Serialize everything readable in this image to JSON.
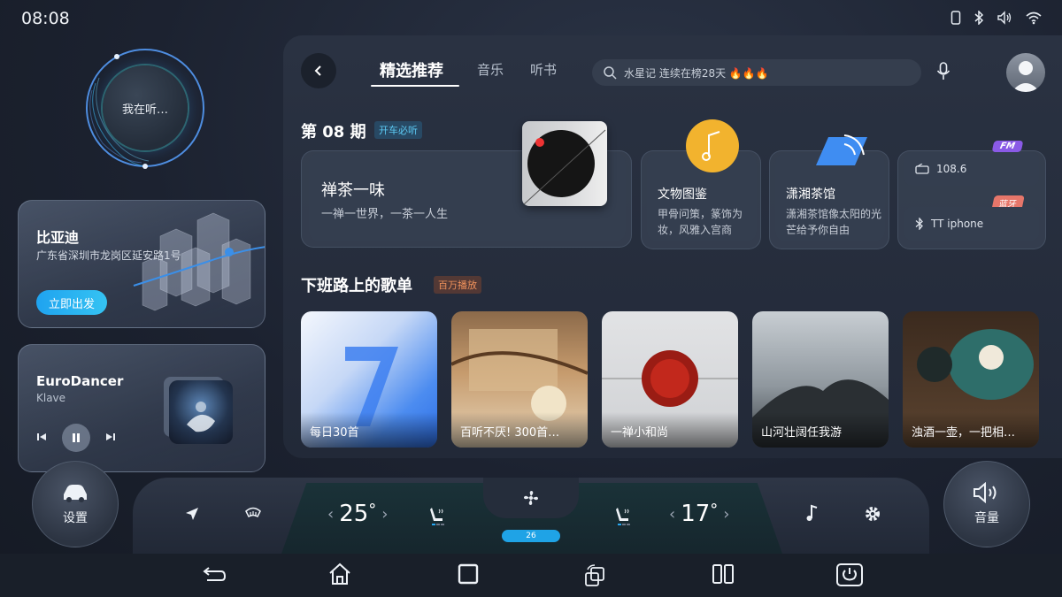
{
  "status_bar": {
    "time": "08:08",
    "icons": [
      "phone-icon",
      "bluetooth-icon",
      "volume-icon",
      "wifi-icon"
    ]
  },
  "listening": {
    "label": "我在听…"
  },
  "nav_card": {
    "title": "比亚迪",
    "address": "广东省深圳市龙岗区延安路1号",
    "button": "立即出发"
  },
  "music_card": {
    "title": "EuroDancer",
    "artist": "Klave"
  },
  "header": {
    "tabs": [
      {
        "label": "精选推荐",
        "active": true
      },
      {
        "label": "音乐",
        "active": false
      },
      {
        "label": "听书",
        "active": false
      }
    ],
    "search_text": "水星记  连续在榜28天  🔥🔥🔥"
  },
  "issue": {
    "title": "第 08 期",
    "tag": "开车必听"
  },
  "feature": {
    "title": "禅茶一味",
    "subtitle": "一禅一世界，一茶一人生"
  },
  "mini_cards": [
    {
      "title": "文物图鉴",
      "desc": "甲骨问策，篆饰为妆，风雅入宫商",
      "icon": "music-note-icon"
    },
    {
      "title": "潇湘茶馆",
      "desc": "潇湘茶馆像太阳的光芒给予你自由",
      "icon": "signal-icon"
    }
  ],
  "radio": {
    "fm_badge": "FM",
    "fm_value": "108.6",
    "bt_badge": "蓝牙",
    "bt_value": "TT iphone"
  },
  "playlist_section": {
    "title": "下班路上的歌单",
    "tag": "百万播放"
  },
  "playlists": [
    {
      "label": "每日30首"
    },
    {
      "label": "百听不厌! 300首…"
    },
    {
      "label": "一禅小和尚"
    },
    {
      "label": "山河壮阔任我游"
    },
    {
      "label": "浊酒一壶，一把相…"
    }
  ],
  "climate": {
    "settings_label": "设置",
    "volume_label": "音量",
    "left_temp": "25",
    "right_temp": "17",
    "degree": "°",
    "fan_level": "26"
  }
}
